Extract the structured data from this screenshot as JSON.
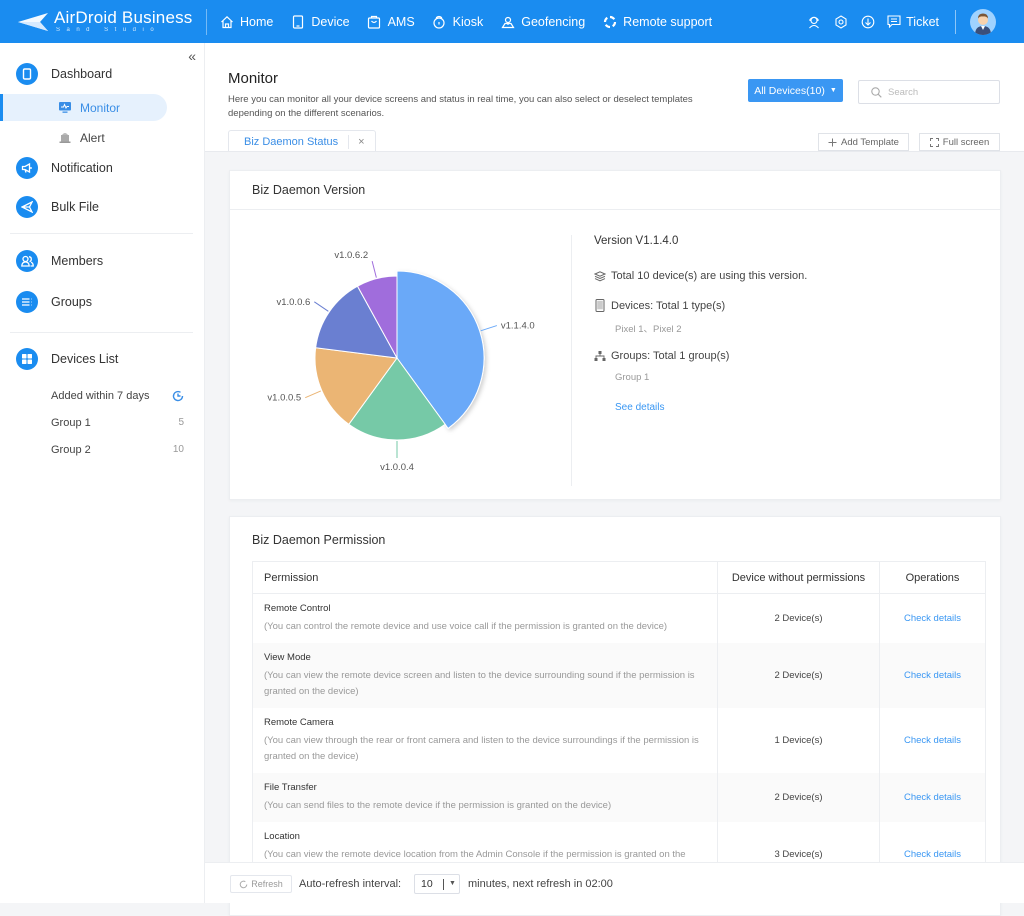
{
  "app": {
    "brand": "AirDroid Business",
    "brand_sub": "Sand Studio",
    "brand_color": "#1a8cf0"
  },
  "topnav": {
    "items": [
      {
        "label": "Home",
        "icon": "home-icon"
      },
      {
        "label": "Device",
        "icon": "device-icon"
      },
      {
        "label": "AMS",
        "icon": "ams-icon"
      },
      {
        "label": "Kiosk",
        "icon": "kiosk-icon"
      },
      {
        "label": "Geofencing",
        "icon": "geofencing-icon"
      },
      {
        "label": "Remote support",
        "icon": "remote-support-icon"
      }
    ],
    "right_icons": [
      "support-agent-icon",
      "settings-icon",
      "download-icon"
    ],
    "ticket_label": "Ticket"
  },
  "sidebar": {
    "collapse_label": "«",
    "items": [
      {
        "label": "Dashboard",
        "icon": "dashboard-icon"
      },
      {
        "label": "Notification",
        "icon": "notification-icon"
      },
      {
        "label": "Bulk File",
        "icon": "bulk-file-icon"
      },
      {
        "label": "Members",
        "icon": "members-icon"
      },
      {
        "label": "Groups",
        "icon": "groups-icon"
      },
      {
        "label": "Devices List",
        "icon": "devices-list-icon"
      }
    ],
    "dashboard_sub": [
      {
        "label": "Monitor",
        "active": true
      },
      {
        "label": "Alert",
        "active": false
      }
    ],
    "devices_list_sub": [
      {
        "label": "Added within 7 days",
        "count": ""
      },
      {
        "label": "Group 1",
        "count": "5"
      },
      {
        "label": "Group 2",
        "count": "10"
      }
    ]
  },
  "header": {
    "title": "Monitor",
    "description": "Here you can monitor all your device screens and status in real time, you can also select or deselect templates depending on the different scenarios.",
    "device_filter": "All Devices(10)",
    "search_placeholder": "Search",
    "tab_label": "Biz Daemon Status",
    "tab_close": "×",
    "add_template": "Add Template",
    "full_screen": "Full screen"
  },
  "version_card": {
    "title": "Biz Daemon Version",
    "selected_version": "Version V1.1.4.0",
    "total_line": "Total 10 device(s) are using this version.",
    "devices_line": "Devices: Total 1 type(s)",
    "devices_sub": "Pixel 1、Pixel 2",
    "groups_line": "Groups: Total 1 group(s)",
    "groups_sub": "Group 1",
    "see_details": "See details"
  },
  "chart_data": {
    "type": "pie",
    "title": "Biz Daemon Version",
    "categories": [
      "v1.1.4.0",
      "v1.0.0.4",
      "v1.0.0.5",
      "v1.0.0.6",
      "v1.0.6.2"
    ],
    "values": [
      40,
      20,
      17,
      15,
      8
    ],
    "colors": [
      "#6aa9f8",
      "#76c9a7",
      "#ebb574",
      "#6a7fd1",
      "#a06ddc"
    ],
    "highlighted": "v1.1.4.0",
    "legend": "none"
  },
  "permission_card": {
    "title": "Biz Daemon Permission",
    "columns": [
      "Permission",
      "Device without permissions",
      "Operations"
    ],
    "rows": [
      {
        "name": "Remote Control",
        "desc": "(You can control the remote device and use voice call if the permission is granted on the device)",
        "count": "2  Device(s)",
        "op": "Check details"
      },
      {
        "name": "View Mode",
        "desc": "(You can view the remote device screen and listen to the device surrounding sound if the permission is granted on the device)",
        "count": "2  Device(s)",
        "op": "Check details"
      },
      {
        "name": "Remote Camera",
        "desc": "(You can view through the rear or front camera and listen to the device surroundings if the permission is granted on the device)",
        "count": "1  Device(s)",
        "op": "Check details"
      },
      {
        "name": "File Transfer",
        "desc": "(You can send files to the remote device if the permission is granted on the device)",
        "count": "2  Device(s)",
        "op": "Check details"
      },
      {
        "name": "Location",
        "desc": "(You can view the remote device location from the Admin Console if the permission is granted on the device)",
        "count": "3  Device(s)",
        "op": "Check details"
      }
    ]
  },
  "footer": {
    "refresh_label": "Refresh",
    "auto_refresh_label": "Auto-refresh interval:",
    "interval_value": "10",
    "next_refresh": "minutes,  next refresh in 02:00"
  }
}
